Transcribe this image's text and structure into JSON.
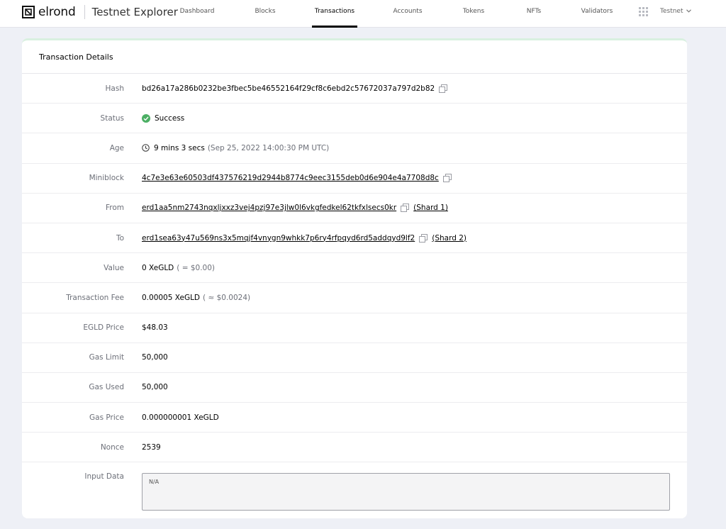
{
  "brand": {
    "name": "elrond",
    "product": "Testnet Explorer"
  },
  "nav": {
    "items": [
      "Dashboard",
      "Blocks",
      "Transactions",
      "Accounts",
      "Tokens",
      "NFTs",
      "Validators"
    ],
    "network": "Testnet"
  },
  "card": {
    "title": "Transaction Details",
    "rows": {
      "hash": {
        "label": "Hash",
        "value": "bd26a17a286b0232be3fbec5be46552164f29cf8c6ebd2c57672037a797d2b82"
      },
      "status": {
        "label": "Status",
        "value": "Success"
      },
      "age": {
        "label": "Age",
        "value": "9 mins 3 secs",
        "timestamp": "(Sep 25, 2022 14:00:30 PM UTC)"
      },
      "miniblock": {
        "label": "Miniblock",
        "value": "4c7e3e63e60503df437576219d2944b8774c9eec3155deb0d6e904e4a7708d8c"
      },
      "from": {
        "label": "From",
        "value": "erd1aa5nm2743nqxljxxz3vej4pzj97e3jlw0l6vkgfedkel62tkfxlsecs0kr",
        "shard": "(Shard 1)"
      },
      "to": {
        "label": "To",
        "value": "erd1sea63y47u569ns3x5mqjf4vnygn9whkk7p6ry4rfpqyd6rd5addqyd9lf2",
        "shard": "(Shard 2)"
      },
      "value": {
        "label": "Value",
        "value": "0 XeGLD",
        "usd": "( = $0.00)"
      },
      "fee": {
        "label": "Transaction Fee",
        "value": "0.00005 XeGLD",
        "usd": "( ≈ $0.0024)"
      },
      "price": {
        "label": "EGLD Price",
        "value": "$48.03"
      },
      "gas_limit": {
        "label": "Gas Limit",
        "value": "50,000"
      },
      "gas_used": {
        "label": "Gas Used",
        "value": "50,000"
      },
      "gas_price": {
        "label": "Gas Price",
        "value": "0.000000001 XeGLD"
      },
      "nonce": {
        "label": "Nonce",
        "value": "2539"
      },
      "input_data": {
        "label": "Input Data",
        "value": "N/A"
      }
    }
  },
  "colors": {
    "success": "#4caf64",
    "accent": "#000000",
    "muted": "#6c6f78"
  }
}
